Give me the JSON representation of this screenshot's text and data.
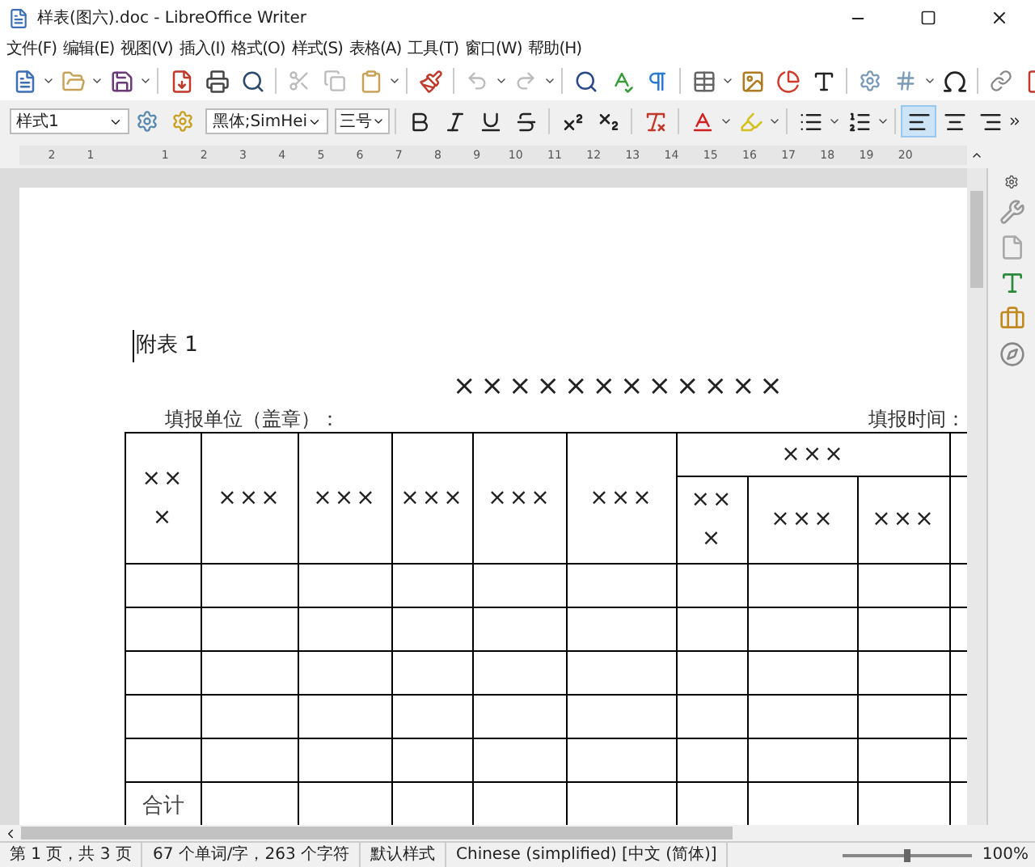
{
  "window": {
    "title": "样表(图六).doc - LibreOffice Writer"
  },
  "menu": [
    "文件(F)",
    "编辑(E)",
    "视图(V)",
    "插入(I)",
    "格式(O)",
    "样式(S)",
    "表格(A)",
    "工具(T)",
    "窗口(W)",
    "帮助(H)"
  ],
  "formatting": {
    "paragraph_style": "样式1",
    "font_name": "黑体;SimHei",
    "font_size": "三号",
    "align_buttons": [
      {
        "selected": true
      },
      {
        "selected": false
      },
      {
        "selected": false
      }
    ]
  },
  "ruler": {
    "labels": [
      "2",
      "1",
      "1",
      "2",
      "3",
      "4",
      "5",
      "6",
      "7",
      "8",
      "9",
      "10",
      "11",
      "12",
      "13",
      "14",
      "15",
      "16",
      "17",
      "18",
      "19",
      "20"
    ]
  },
  "document": {
    "heading": "附表 1",
    "title": "××××××××××××",
    "fill_unit": "填报单位（盖章）：",
    "fill_time": "填报时间：",
    "table": {
      "header_cells": [
        "×××",
        "×××",
        "×××",
        "×××",
        "×××",
        "×××"
      ],
      "group_header": "×××",
      "sub_headers": [
        "×××",
        "×××",
        "×××"
      ],
      "empty_rows": [
        "",
        "",
        "",
        "",
        ""
      ],
      "total_label": "合计"
    }
  },
  "status_bar": {
    "page": "第 1 页，共 3 页",
    "words": "67 个单词/字，263 个字符",
    "style": "默认样式",
    "language": "Chinese (simplified) [中文 (简体)]",
    "zoom": "100%",
    "zoom_slider": {
      "level": 0.5
    }
  }
}
